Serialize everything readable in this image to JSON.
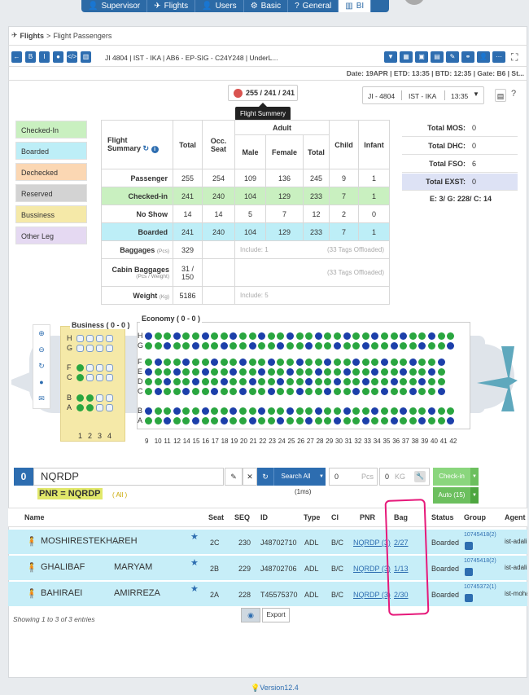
{
  "topnav": {
    "tabs": [
      "Supervisor",
      "Flights",
      "Users",
      "Basic",
      "General",
      "BI"
    ]
  },
  "breadcrumb": {
    "a": "Flights",
    "sep": ">",
    "b": "Flight Passengers"
  },
  "toolbar": {
    "left": [
      "←",
      "B",
      "I",
      "●",
      "</>",
      "▥"
    ],
    "flight_line": "JI 4804 | IST - IKA | AB6 - EP-SIG - C24Y248 | UnderL...",
    "right": [
      "▼",
      "▦",
      "▣",
      "▤",
      "✎",
      "⚭",
      "👤",
      "···"
    ],
    "expand": "⛶"
  },
  "dates": "Date: 19APR | ETD: 13:35 | BTD: 12:35 | Gate: B6 | St...",
  "summary_btn": {
    "counts": "255 / 241 / 241",
    "tooltip": "Flight Summery"
  },
  "flight_select": {
    "code": "JI - 4804",
    "route": "IST - IKA",
    "time": "13:35"
  },
  "legend": [
    {
      "label": "Checked-In",
      "color": "#c9f0c0"
    },
    {
      "label": "Boarded",
      "color": "#bdeef7"
    },
    {
      "label": "Dechecked",
      "color": "#fbd7b3"
    },
    {
      "label": "Reserved",
      "color": "#d3d3d3"
    },
    {
      "label": "Bussiness",
      "color": "#f5e9a8"
    },
    {
      "label": "Other Leg",
      "color": "#e5d9f2"
    }
  ],
  "flight_summary": {
    "title1": "Flight",
    "title2": "Summary",
    "headers": {
      "total": "Total",
      "occ": "Occ.",
      "occ2": "Seat",
      "adult": "Adult",
      "male": "Male",
      "female": "Female",
      "atotal": "Total",
      "child": "Child",
      "infant": "Infant"
    },
    "rows": [
      {
        "label": "Passenger",
        "total": "255",
        "occ": "254",
        "male": "109",
        "female": "136",
        "atotal": "245",
        "child": "9",
        "infant": "1"
      },
      {
        "label": "Checked-in",
        "total": "241",
        "occ": "240",
        "male": "104",
        "female": "129",
        "atotal": "233",
        "child": "7",
        "infant": "1"
      },
      {
        "label": "No Show",
        "total": "14",
        "occ": "14",
        "male": "5",
        "female": "7",
        "atotal": "12",
        "child": "2",
        "infant": "0"
      },
      {
        "label": "Boarded",
        "total": "241",
        "occ": "240",
        "male": "104",
        "female": "129",
        "atotal": "233",
        "child": "7",
        "infant": "1"
      }
    ],
    "baggages": {
      "label": "Baggages",
      "unit": "(Pcs)",
      "value": "329",
      "include": "Include: 1",
      "offloaded": "(33 Tags Offloaded)"
    },
    "cabin": {
      "label": "Cabin Baggages",
      "unit": "(Pcs / Weight)",
      "value1": "31 /",
      "value2": "150",
      "offloaded": "(33 Tags Offloaded)"
    },
    "weight": {
      "label": "Weight",
      "unit": "(Kg)",
      "value": "5186",
      "include": "Include: 5"
    }
  },
  "mos": [
    {
      "k": "Total MOS:",
      "v": "0"
    },
    {
      "k": "Total DHC:",
      "v": "0"
    },
    {
      "k": "Total FSO:",
      "v": "6"
    },
    {
      "k": "Total EXST:",
      "v": "0"
    }
  ],
  "egc": "E: 3/ G: 228/ C: 14",
  "seatmap": {
    "business": "Business ( 0 - 0 )",
    "economy": "Economy ( 0 - 0 )",
    "biz_rows": [
      "H",
      "G",
      "F",
      "C",
      "B",
      "A"
    ],
    "eco_rows": [
      "H",
      "G",
      "F",
      "E",
      "D",
      "C",
      "B",
      "A"
    ],
    "biz_cols": [
      "1",
      "2",
      "3",
      "4"
    ],
    "eco_cols": [
      "9",
      "10",
      "11",
      "12",
      "14",
      "15",
      "16",
      "17",
      "18",
      "19",
      "20",
      "21",
      "22",
      "23",
      "24",
      "25",
      "26",
      "27",
      "28",
      "29",
      "30",
      "31",
      "32",
      "33",
      "34",
      "35",
      "36",
      "37",
      "38",
      "39",
      "40",
      "41",
      "42"
    ]
  },
  "search": {
    "count": "0",
    "value": "NQRDP",
    "search_all": "Search All",
    "ms": "(1ms)",
    "pcs_value": "0",
    "pcs": "Pcs",
    "kg_value": "0",
    "kg": "KG",
    "checkin": "Check-in",
    "auto": "Auto (15)",
    "pnr_tag": "PNR = NQRDP",
    "all": "( All )"
  },
  "table": {
    "headers": [
      "Name",
      "Seat",
      "SEQ",
      "ID",
      "Type",
      "Cl",
      "PNR",
      "Bag",
      "Status",
      "Group",
      "Agent"
    ],
    "rows": [
      {
        "first": "MOSHIRESTEKHAREH",
        "last": "…",
        "seat": "2C",
        "seq": "230",
        "id": "J48702710",
        "type": "ADL",
        "cl": "B/C",
        "pnr": "NQRDP (3)",
        "bag": "2/27",
        "status": "Boarded",
        "group": "10745418(2)",
        "agent": "ist-adali",
        "gender": "f"
      },
      {
        "first": "GHALIBAF",
        "last": "MARYAM",
        "seat": "2B",
        "seq": "229",
        "id": "J48702706",
        "type": "ADL",
        "cl": "B/C",
        "pnr": "NQRDP (3)",
        "bag": "1/13",
        "status": "Boarded",
        "group": "10745418(2)",
        "agent": "ist-adali",
        "gender": "f"
      },
      {
        "first": "BAHIRAEI",
        "last": "AMIRREZA",
        "seat": "2A",
        "seq": "228",
        "id": "T45575370",
        "type": "ADL",
        "cl": "B/C",
        "pnr": "NQRDP (3)",
        "bag": "2/30",
        "status": "Boarded",
        "group": "10745372(1)",
        "agent": "ist-mohamm",
        "gender": "m"
      }
    ]
  },
  "footer": {
    "showing": "Showing 1 to 3 of 3 entries",
    "export": "Export",
    "version": "Version12.4"
  }
}
